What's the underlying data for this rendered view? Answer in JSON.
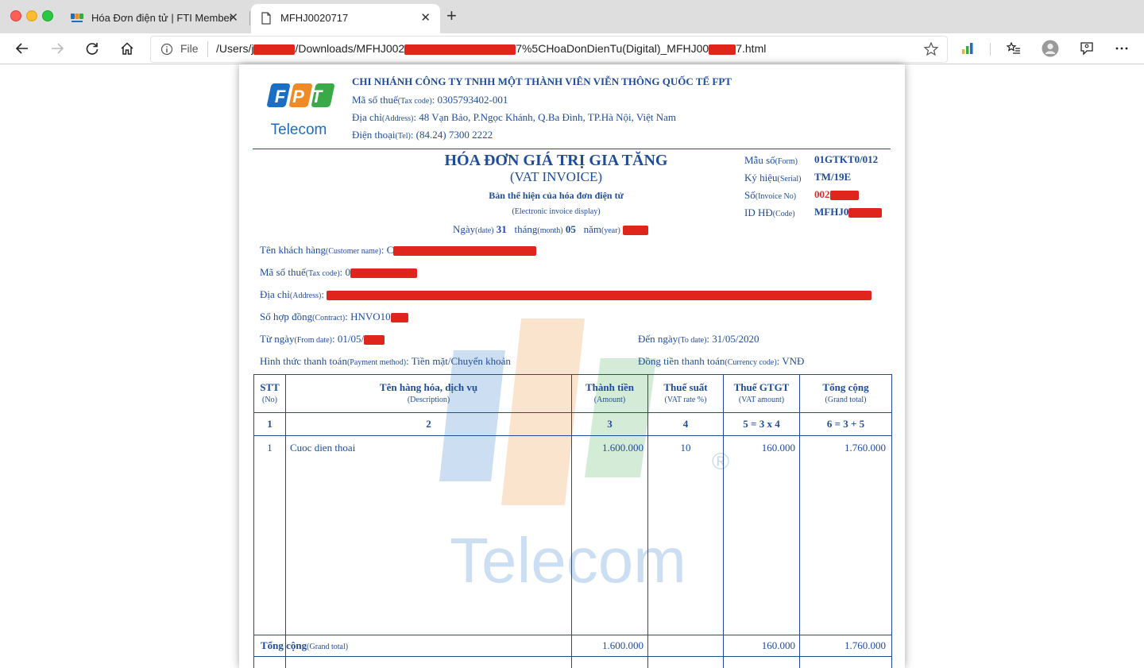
{
  "browser": {
    "tabs": [
      {
        "title": "Hóa Đơn điện tử | FTI Member",
        "active": false
      },
      {
        "title": "MFHJ0020717",
        "active": true
      }
    ],
    "address": {
      "scheme_label": "File",
      "url_part1": "/Users/j",
      "url_part2": "/Downloads/MFHJ002",
      "url_part3": "7%5CHoaDonDienTu(Digital)_MFHJ00",
      "url_part4": "7.html"
    },
    "icons": [
      "back-icon",
      "forward-icon",
      "refresh-icon",
      "home-icon",
      "info-icon",
      "star-icon",
      "chart-extension-icon",
      "favorites-icon",
      "profile-icon",
      "feedback-icon",
      "more-icon"
    ]
  },
  "invoice": {
    "logo_text": "FPT",
    "logo_sub": "Telecom",
    "company_name": "CHI NHÁNH CÔNG TY TNHH MỘT THÀNH VIÊN VIỄN THÔNG QUỐC TẾ FPT",
    "tax_label": "Mã số thuế",
    "tax_label_en": "(Tax code)",
    "tax_value": ": 0305793402-001",
    "address_label": "Địa chỉ",
    "address_label_en": "(Address)",
    "address_value": ": 48 Vạn Bảo, P.Ngọc Khánh, Q.Ba Đình, TP.Hà Nội, Việt Nam",
    "phone_label": "Điện thoại",
    "phone_label_en": "(Tel)",
    "phone_value": ": (84.24) 7300 2222",
    "title": "HÓA ĐƠN GIÁ TRỊ GIA TĂNG",
    "title_en": "(VAT INVOICE)",
    "subtitle": "Bản thể hiện của hóa đơn điện tử",
    "subtitle_en": "(Electronic invoice display)",
    "date": {
      "day_label": "Ngày",
      "day_label_en": "(date)",
      "day": "31",
      "month_label": "tháng",
      "month_label_en": "(month)",
      "month": "05",
      "year_label": "năm",
      "year_label_en": "(year)"
    },
    "meta": {
      "form_label": "Mẫu số",
      "form_label_en": "(Form)",
      "form_value": "01GTKT0/012",
      "serial_label": "Ký hiệu",
      "serial_label_en": "(Serial)",
      "serial_value": "TM/19E",
      "no_label": "Số",
      "no_label_en": "(Invoice No)",
      "no_value": "002",
      "id_label": "ID HĐ",
      "id_label_en": "(Code)",
      "id_value": "MFHJ0"
    },
    "customer": {
      "name_label": "Tên khách hàng",
      "name_label_en": "(Customer name)",
      "name_value": ": C",
      "tax_label": "Mã số thuế",
      "tax_label_en": "(Tax code)",
      "tax_value": ": 0",
      "addr_label": "Địa chỉ",
      "addr_label_en": "(Address)",
      "addr_value": ": ",
      "contract_label": "Số hợp đồng",
      "contract_label_en": "(Contract)",
      "contract_value": ": HNVO10",
      "from_label": "Từ ngày",
      "from_label_en": "(From date)",
      "from_value": ": 01/05/",
      "to_label": "Đến ngày",
      "to_label_en": "(To date)",
      "to_value": ": 31/05/2020",
      "payment_label": "Hình thức thanh toán",
      "payment_label_en": "(Payment method)",
      "payment_value": ": Tiền mặt/Chuyển khoản",
      "currency_label": "Đồng tiền thanh toán",
      "currency_label_en": "(Currency code)",
      "currency_value": ": VNĐ"
    },
    "table": {
      "headers": [
        {
          "vi": "STT",
          "en": "(No)"
        },
        {
          "vi": "Tên hàng hóa, dịch vụ",
          "en": "(Description)"
        },
        {
          "vi": "Thành tiền",
          "en": "(Amount)"
        },
        {
          "vi": "Thuế suất",
          "en": "(VAT rate %)"
        },
        {
          "vi": "Thuế GTGT",
          "en": "(VAT amount)"
        },
        {
          "vi": "Tổng cộng",
          "en": "(Grand total)"
        }
      ],
      "numbering": [
        "1",
        "2",
        "3",
        "4",
        "5 = 3 x 4",
        "6 = 3 + 5"
      ],
      "rows": [
        {
          "no": "1",
          "desc": "Cuoc dien thoai",
          "amount": "1.600.000",
          "rate": "10",
          "vat": "160.000",
          "total": "1.760.000"
        }
      ],
      "total_label": "Tổng cộng",
      "total_label_en": "(Grand total)",
      "total_amount": "1.600.000",
      "total_vat": "160.000",
      "total_grand": "1.760.000"
    },
    "watermark_text": "Telecom",
    "watermark_reg": "®"
  }
}
